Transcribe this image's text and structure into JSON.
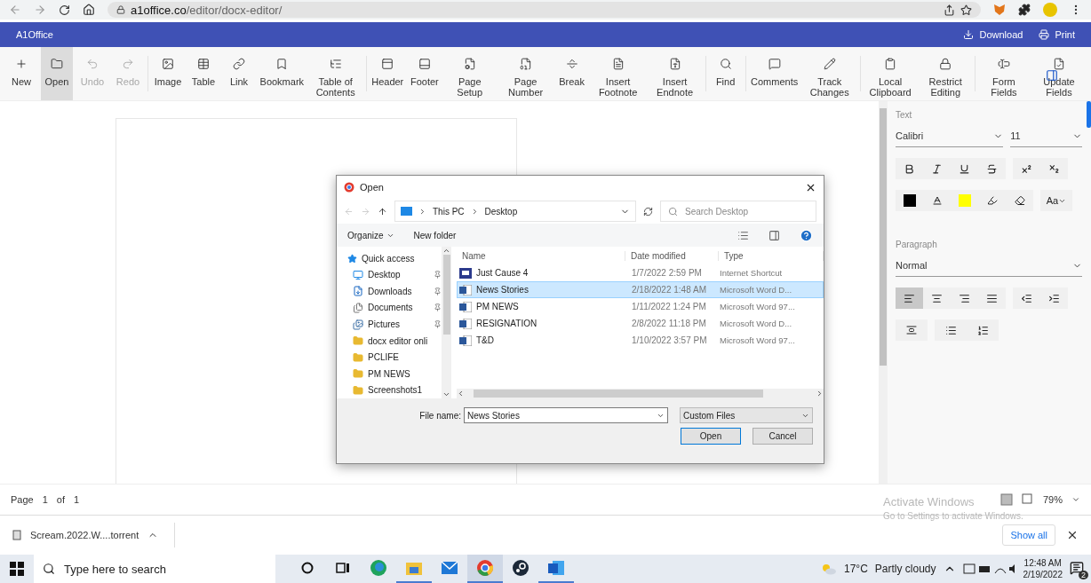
{
  "browser": {
    "url_host": "a1office.co",
    "url_path": "/editor/docx-editor/"
  },
  "app_bar": {
    "title": "A1Office",
    "actions": [
      "Download",
      "Print"
    ]
  },
  "toolbar": {
    "groups": [
      [
        {
          "label": "New",
          "selected": false,
          "disabled": false
        },
        {
          "label": "Open",
          "selected": true,
          "disabled": false
        },
        {
          "label": "Undo",
          "selected": false,
          "disabled": true
        },
        {
          "label": "Redo",
          "selected": false,
          "disabled": true
        }
      ],
      [
        {
          "label": "Image",
          "selected": false,
          "disabled": false
        },
        {
          "label": "Table",
          "selected": false,
          "disabled": false
        },
        {
          "label": "Link",
          "selected": false,
          "disabled": false
        },
        {
          "label": "Bookmark",
          "selected": false,
          "disabled": false
        },
        {
          "label": "Table of Contents",
          "selected": false,
          "disabled": false
        }
      ],
      [
        {
          "label": "Header",
          "selected": false,
          "disabled": false
        },
        {
          "label": "Footer",
          "selected": false,
          "disabled": false
        },
        {
          "label": "Page Setup",
          "selected": false,
          "disabled": false
        },
        {
          "label": "Page Number",
          "selected": false,
          "disabled": false
        },
        {
          "label": "Break",
          "selected": false,
          "disabled": false
        },
        {
          "label": "Insert Footnote",
          "selected": false,
          "disabled": false
        },
        {
          "label": "Insert Endnote",
          "selected": false,
          "disabled": false
        }
      ],
      [
        {
          "label": "Find",
          "selected": false,
          "disabled": false
        }
      ],
      [
        {
          "label": "Comments",
          "selected": false,
          "disabled": false
        },
        {
          "label": "Track Changes",
          "selected": false,
          "disabled": false
        }
      ],
      [
        {
          "label": "Local Clipboard",
          "selected": false,
          "disabled": false
        },
        {
          "label": "Restrict Editing",
          "selected": false,
          "disabled": false
        }
      ],
      [
        {
          "label": "Form Fields",
          "selected": false,
          "disabled": false
        },
        {
          "label": "Update Fields",
          "selected": false,
          "disabled": false
        }
      ]
    ]
  },
  "format_panel": {
    "text_heading": "Text",
    "font": "Calibri",
    "size": "11",
    "styles": [
      {
        "selected": false
      },
      {
        "selected": false
      },
      {
        "selected": false
      },
      {
        "selected": false
      },
      {
        "selected": false
      },
      {
        "selected": false
      }
    ],
    "case_label": "Aa",
    "paragraph_heading": "Paragraph",
    "paragraph_style": "Normal",
    "alignments": [
      {
        "selected": true
      },
      {
        "selected": false
      },
      {
        "selected": false
      },
      {
        "selected": false
      }
    ]
  },
  "open_dialog": {
    "title": "Open",
    "path": [
      "This PC",
      "Desktop"
    ],
    "search_placeholder": "Search Desktop",
    "commands": [
      "Organize",
      "New folder"
    ],
    "nav": [
      {
        "label": "Quick access",
        "children": [
          {
            "label": "Desktop",
            "kind": "desktop",
            "pinned": true
          },
          {
            "label": "Downloads",
            "kind": "downloads",
            "pinned": true
          },
          {
            "label": "Documents",
            "kind": "documents",
            "pinned": true
          },
          {
            "label": "Pictures",
            "kind": "pictures",
            "pinned": true
          },
          {
            "label": "docx editor onli",
            "kind": "folder",
            "pinned": false
          },
          {
            "label": "PCLIFE",
            "kind": "folder",
            "pinned": false
          },
          {
            "label": "PM NEWS",
            "kind": "folder",
            "pinned": false
          },
          {
            "label": "Screenshots1",
            "kind": "folder",
            "pinned": false
          }
        ]
      }
    ],
    "columns": [
      "Name",
      "Date modified",
      "Type"
    ],
    "files": [
      {
        "name": "Just Cause 4",
        "date": "1/7/2022 2:59 PM",
        "type": "Internet Shortcut",
        "kind": "shortcut",
        "selected": false
      },
      {
        "name": "News Stories",
        "date": "2/18/2022 1:48 AM",
        "type": "Microsoft Word D...",
        "kind": "word",
        "selected": true
      },
      {
        "name": "PM NEWS",
        "date": "1/11/2022 1:24 PM",
        "type": "Microsoft Word 97...",
        "kind": "word",
        "selected": false
      },
      {
        "name": "RESIGNATION",
        "date": "2/8/2022 11:18 PM",
        "type": "Microsoft Word D...",
        "kind": "word",
        "selected": false
      },
      {
        "name": "T&D",
        "date": "1/10/2022 3:57 PM",
        "type": "Microsoft Word 97...",
        "kind": "word",
        "selected": false
      }
    ],
    "file_name_label": "File name:",
    "file_name": "News Stories",
    "filter": "Custom Files",
    "buttons": [
      "Open",
      "Cancel"
    ]
  },
  "status_bar": {
    "page_label": "Page",
    "current": "1",
    "of": "of",
    "total": "1",
    "zoom": "79%"
  },
  "activation": {
    "title": "Activate Windows",
    "hint": "Go to Settings to activate Windows."
  },
  "downloads_bar": {
    "file": "Scream.2022.W....torrent",
    "show_all": "Show all"
  },
  "taskbar": {
    "search_placeholder": "Type here to search",
    "apps": [
      {
        "selected": false,
        "running": false
      },
      {
        "selected": false,
        "running": false
      },
      {
        "selected": false,
        "running": false
      },
      {
        "selected": false,
        "running": true
      },
      {
        "selected": false,
        "running": false
      },
      {
        "selected": true,
        "running": true
      },
      {
        "selected": false,
        "running": false
      },
      {
        "selected": false,
        "running": true
      }
    ],
    "temperature": "17°C",
    "weather": "Partly cloudy",
    "time": "12:48 AM",
    "date": "2/19/2022",
    "notifications": "2"
  }
}
